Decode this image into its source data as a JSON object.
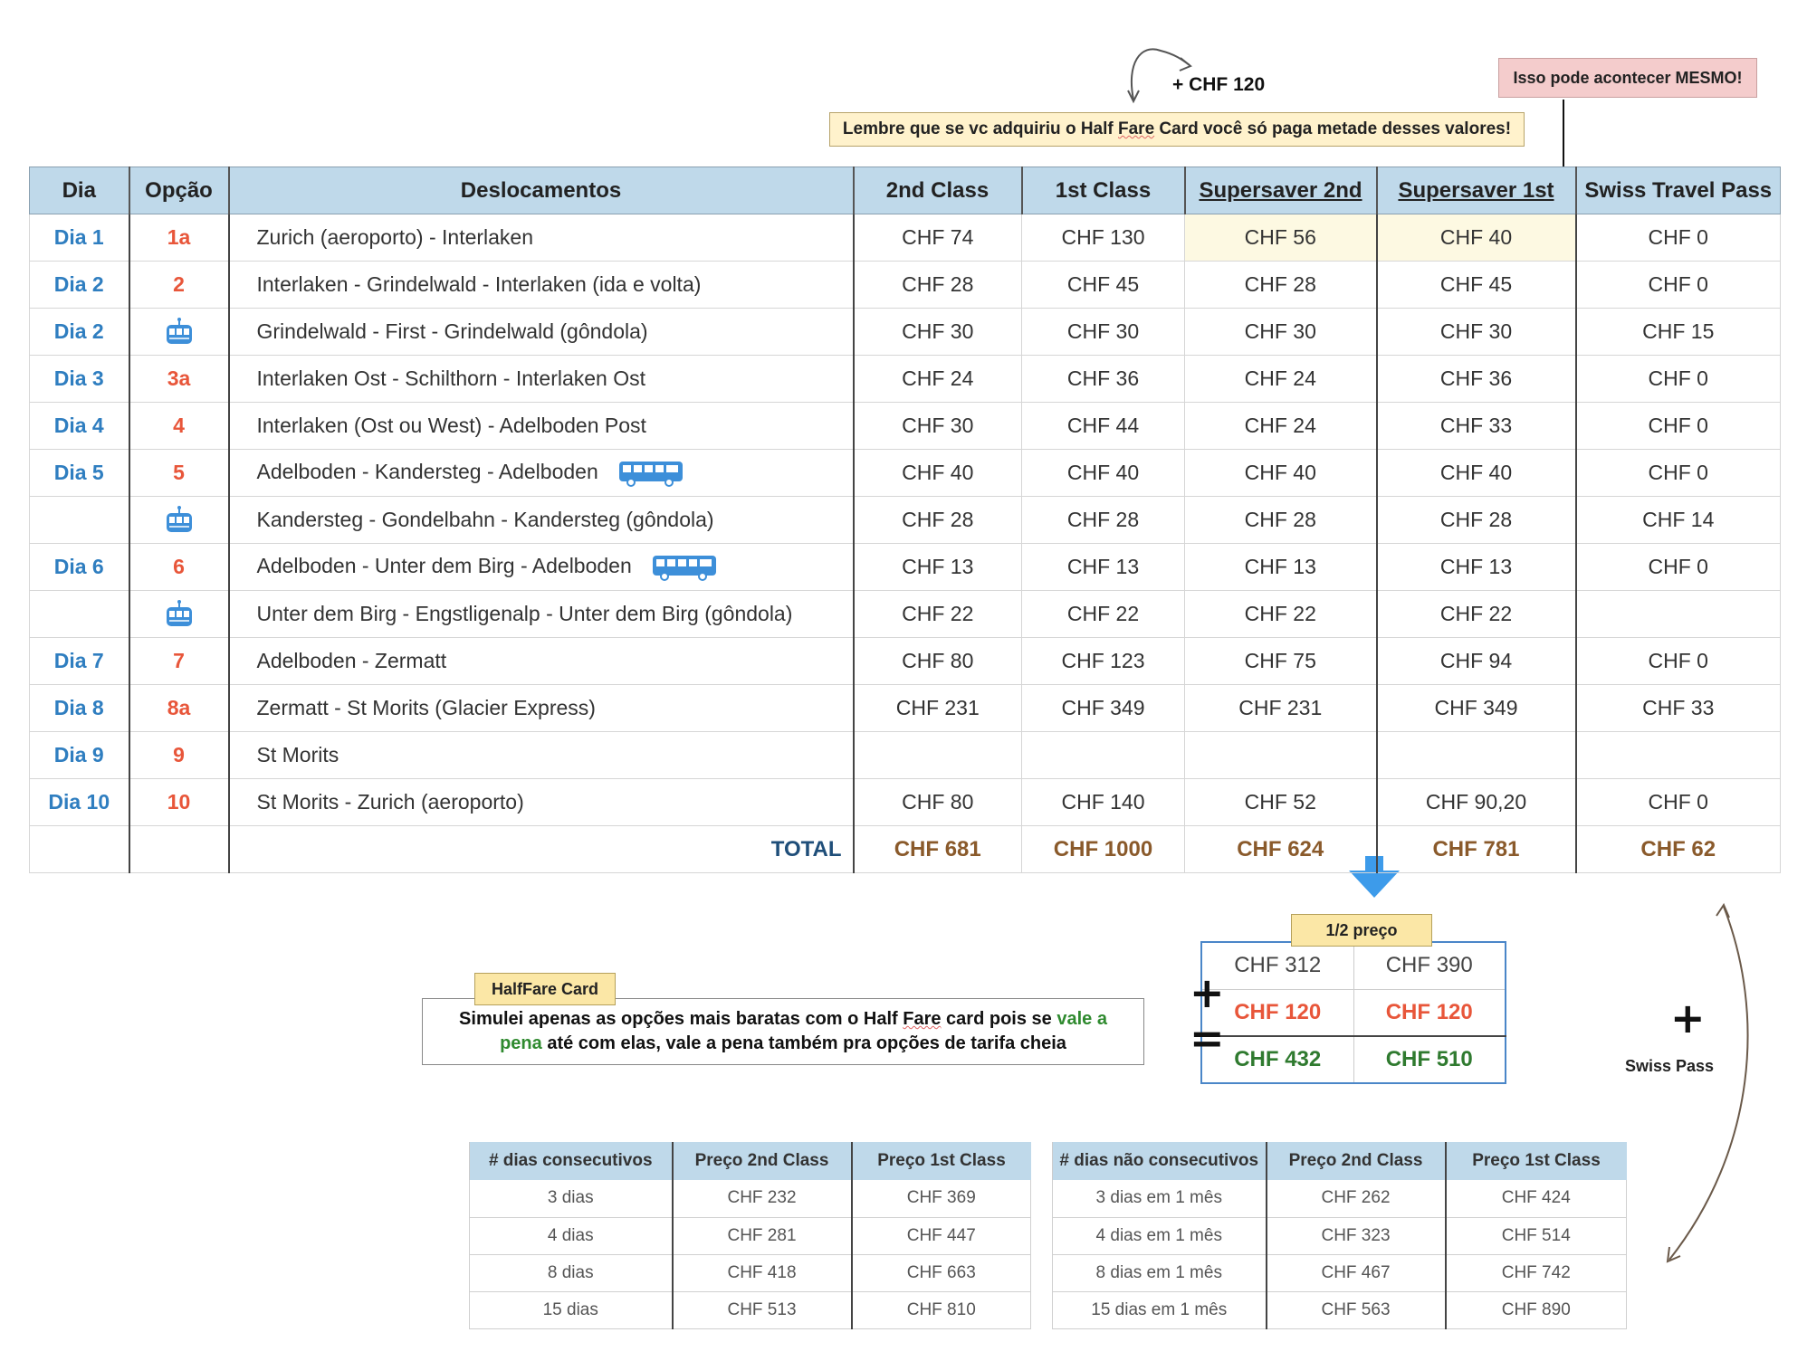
{
  "notes": {
    "plus_chf": "+ CHF 120",
    "half_fare_reminder_pre": "Lembre que se vc adquiriu o Half ",
    "half_fare_reminder_fare": "Fare",
    "half_fare_reminder_post": " Card você só paga metade desses valores!",
    "warning": "Isso pode acontecer MESMO!"
  },
  "main_table": {
    "headers": [
      "Dia",
      "Opção",
      "Deslocamentos",
      "2nd Class",
      "1st Class",
      "Supersaver 2nd",
      "Supersaver 1st",
      "Swiss Travel Pass"
    ],
    "rows": [
      {
        "dia": "Dia 1",
        "opcao": "1a",
        "desl": "Zurich (aeroporto) - Interlaken",
        "c2": "CHF 74",
        "c1": "CHF 130",
        "s2": "CHF 56",
        "s1": "CHF 40",
        "stp": "CHF 0"
      },
      {
        "dia": "Dia 2",
        "opcao": "2",
        "desl": "Interlaken - Grindelwald - Interlaken (ida e volta)",
        "c2": "CHF 28",
        "c1": "CHF 45",
        "s2": "CHF 28",
        "s1": "CHF 45",
        "stp": "CHF 0"
      },
      {
        "dia": "Dia 2",
        "opcao": "",
        "icon_opcao": "gondola-icon",
        "desl": "Grindelwald - First - Grindelwald (gôndola)",
        "c2": "CHF 30",
        "c1": "CHF 30",
        "s2": "CHF 30",
        "s1": "CHF 30",
        "stp": "CHF 15"
      },
      {
        "dia": "Dia 3",
        "opcao": "3a",
        "desl": "Interlaken Ost - Schilthorn - Interlaken Ost",
        "c2": "CHF 24",
        "c1": "CHF 36",
        "s2": "CHF 24",
        "s1": "CHF 36",
        "stp": "CHF 0"
      },
      {
        "dia": "Dia 4",
        "opcao": "4",
        "desl": "Interlaken (Ost ou West) - Adelboden Post",
        "c2": "CHF 30",
        "c1": "CHF 44",
        "s2": "CHF 24",
        "s1": "CHF 33",
        "stp": "CHF 0"
      },
      {
        "dia": "Dia 5",
        "opcao": "5",
        "desl": "Adelboden - Kandersteg - Adelboden",
        "icon_desl": "bus-icon",
        "c2": "CHF 40",
        "c1": "CHF 40",
        "s2": "CHF 40",
        "s1": "CHF 40",
        "stp": "CHF 0"
      },
      {
        "dia": "",
        "opcao": "",
        "icon_opcao": "gondola-icon",
        "desl": "Kandersteg - Gondelbahn - Kandersteg (gôndola)",
        "c2": "CHF 28",
        "c1": "CHF 28",
        "s2": "CHF 28",
        "s1": "CHF 28",
        "stp": "CHF 14"
      },
      {
        "dia": "Dia 6",
        "opcao": "6",
        "desl": "Adelboden - Unter dem Birg - Adelboden",
        "icon_desl": "bus-icon",
        "c2": "CHF 13",
        "c1": "CHF 13",
        "s2": "CHF 13",
        "s1": "CHF 13",
        "stp": "CHF 0"
      },
      {
        "dia": "",
        "opcao": "",
        "icon_opcao": "gondola-icon",
        "desl": "Unter dem Birg - Engstligenalp - Unter dem Birg (gôndola)",
        "c2": "CHF 22",
        "c1": "CHF 22",
        "s2": "CHF 22",
        "s1": "CHF 22",
        "stp": ""
      },
      {
        "dia": "Dia 7",
        "opcao": "7",
        "desl": "Adelboden - Zermatt",
        "c2": "CHF 80",
        "c1": "CHF 123",
        "s2": "CHF 75",
        "s1": "CHF 94",
        "stp": "CHF 0"
      },
      {
        "dia": "Dia 8",
        "opcao": "8a",
        "desl": "Zermatt - St Morits (Glacier Express)",
        "c2": "CHF 231",
        "c1": "CHF 349",
        "s2": "CHF 231",
        "s1": "CHF 349",
        "stp": "CHF 33"
      },
      {
        "dia": "Dia 9",
        "opcao": "9",
        "desl": "St Morits",
        "c2": "",
        "c1": "",
        "s2": "",
        "s1": "",
        "stp": ""
      },
      {
        "dia": "Dia 10",
        "opcao": "10",
        "desl": "St Morits - Zurich (aeroporto)",
        "c2": "CHF 80",
        "c1": "CHF 140",
        "s2": "CHF 52",
        "s1": "CHF 90,20",
        "stp": "CHF 0"
      }
    ],
    "total": {
      "label": "TOTAL",
      "c2": "CHF 681",
      "c1": "CHF 1000",
      "s2": "CHF 624",
      "s1": "CHF 781",
      "stp": "CHF 62"
    }
  },
  "halffare": {
    "tag": "HalfFare Card",
    "text_pre": "Simulei apenas as opções mais baratas com o Half ",
    "text_fare": "Fare",
    "text_mid": " card pois se ",
    "text_green1": "vale a",
    "text_green2": "pena",
    "text_post": " até com elas, vale a pena também pra opções de tarifa cheia"
  },
  "half_price": {
    "tag": "1/2 preço",
    "rows": [
      [
        "CHF 312",
        "CHF 390"
      ],
      [
        "CHF 120",
        "CHF 120"
      ],
      [
        "CHF 432",
        "CHF 510"
      ]
    ],
    "plus": "+",
    "equals": "="
  },
  "swiss_pass": {
    "plus": "+",
    "label": "Swiss Pass"
  },
  "consecutive": {
    "headers": [
      "# dias consecutivos",
      "Preço 2nd Class",
      "Preço 1st Class"
    ],
    "rows": [
      [
        "3 dias",
        "CHF 232",
        "CHF 369"
      ],
      [
        "4 dias",
        "CHF 281",
        "CHF 447"
      ],
      [
        "8 dias",
        "CHF 418",
        "CHF 663"
      ],
      [
        "15 dias",
        "CHF 513",
        "CHF 810"
      ]
    ]
  },
  "nonconsecutive": {
    "headers": [
      "# dias não consecutivos",
      "Preço 2nd Class",
      "Preço 1st Class"
    ],
    "rows": [
      [
        "3 dias em 1 mês",
        "CHF 262",
        "CHF 424"
      ],
      [
        "4 dias em 1 mês",
        "CHF 323",
        "CHF 514"
      ],
      [
        "8 dias em 1 mês",
        "CHF 467",
        "CHF 742"
      ],
      [
        "15 dias em 1 mês",
        "CHF 563",
        "CHF 890"
      ]
    ]
  },
  "colors": {
    "header_bg": "#bfd9ea",
    "dia": "#2f7ec0",
    "opcao": "#e8563a",
    "total": "#8a5a2b",
    "green": "#2f8a2f",
    "arrow_blue": "#3d9bea"
  }
}
